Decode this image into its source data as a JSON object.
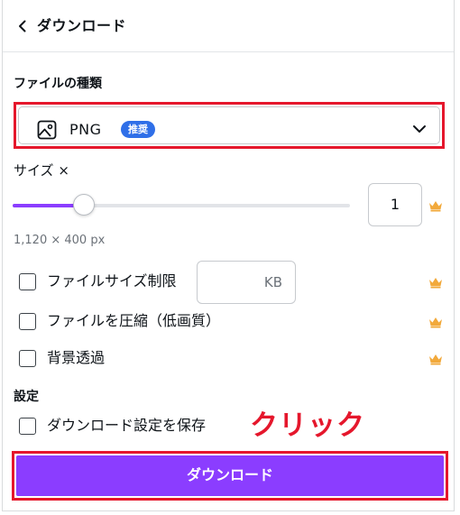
{
  "header": {
    "title": "ダウンロード"
  },
  "file_type": {
    "section_label": "ファイルの種類",
    "value": "PNG",
    "badge": "推奨",
    "icon": "image-icon"
  },
  "size": {
    "label": "サイズ ×",
    "value": "1",
    "slider_fraction": 0.21,
    "dimensions": "1,120 × 400 px"
  },
  "options": [
    {
      "label": "ファイルサイズ制限",
      "checked": false,
      "unit": "KB",
      "premium": true
    },
    {
      "label": "ファイルを圧縮（低画質）",
      "checked": false,
      "premium": true
    },
    {
      "label": "背景透過",
      "checked": false,
      "premium": true
    }
  ],
  "settings": {
    "section_label": "設定",
    "save_label": "ダウンロード設定を保存",
    "checked": false
  },
  "annotation": "クリック",
  "download_button": "ダウンロード",
  "colors": {
    "accent": "#8b3dff",
    "highlight": "#e5172c",
    "badge": "#2f6fe8",
    "crown": "#f2a93b"
  }
}
